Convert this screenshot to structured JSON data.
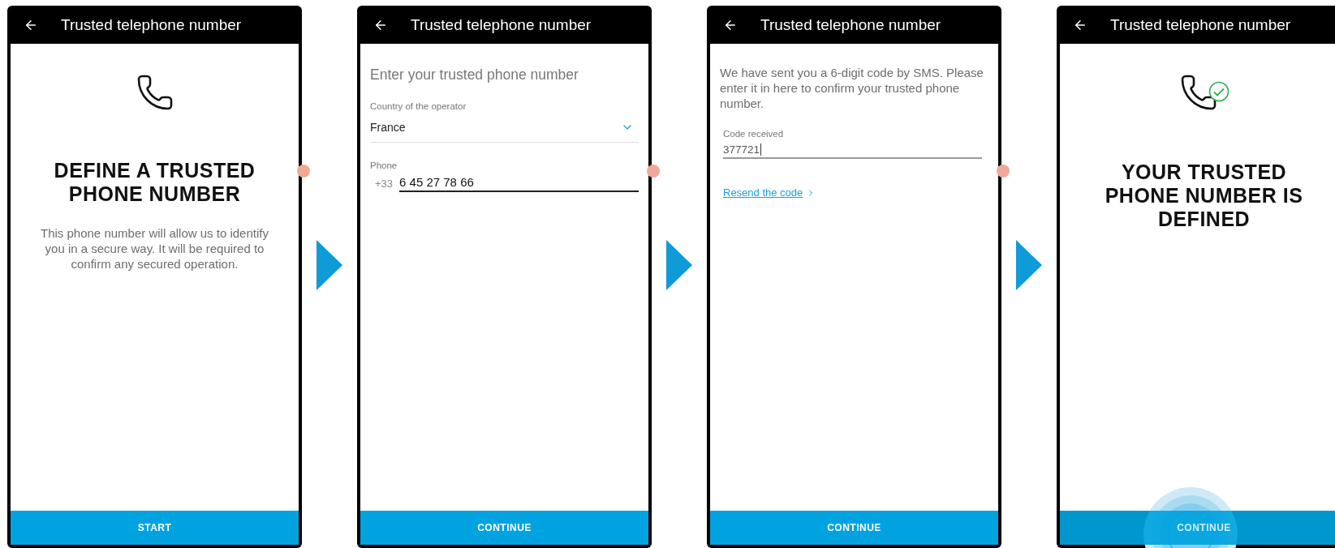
{
  "screens": [
    {
      "kind": "intro",
      "title": "Trusted telephone number",
      "heading": "DEFINE A TRUSTED PHONE NUMBER",
      "text": "This phone number will allow us to identify you in a secure way. It will be required to confirm any secured operation.",
      "button": "START"
    },
    {
      "kind": "phone_entry",
      "title": "Trusted telephone number",
      "subtitle": "Enter your trusted phone number",
      "country_label": "Country of the operator",
      "country": "France",
      "phone_label": "Phone",
      "prefix": "+33",
      "phone": "6 45 27 78 66",
      "button": "CONTINUE"
    },
    {
      "kind": "code_entry",
      "title": "Trusted telephone number",
      "text": "We have sent you a 6-digit code by SMS. Please enter it in here to confirm your trusted phone number.",
      "code_label": "Code received",
      "code": "377721",
      "link": "Resend the code",
      "button": "CONTINUE"
    },
    {
      "kind": "success",
      "title": "Trusted telephone number",
      "heading": "YOUR TRUSTED PHONE NUMBER IS DEFINED",
      "button": "CONTINUE"
    }
  ]
}
